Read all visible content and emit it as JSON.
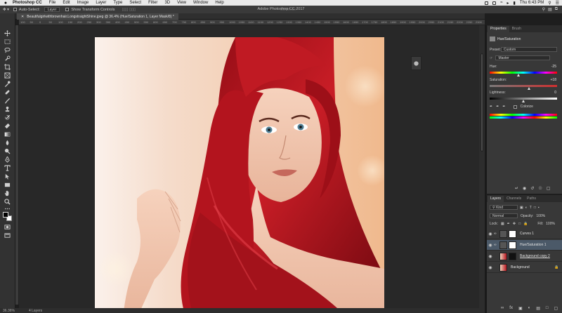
{
  "menubar": {
    "app_name": "Photoshop CC",
    "items": [
      "File",
      "Edit",
      "Image",
      "Layer",
      "Type",
      "Select",
      "Filter",
      "3D",
      "View",
      "Window",
      "Help"
    ],
    "time": "Thu 6:43 PM"
  },
  "window_title": "Adobe Photoshop CC 2017",
  "options_bar": {
    "auto_select_label": "Auto-Select:",
    "auto_select_value": "Layer",
    "show_transform_label": "Show Transform Controls",
    "mode_3d": "3D Mode:"
  },
  "document": {
    "tab_title": "Beautifulgirlwithbrownhair.LongstraightShine.jpeg @ 36.4% (Hue/Saturation 1, Layer Mask/8) *",
    "zoom": "36.36%",
    "layers_count": "4 Layers"
  },
  "ruler": [
    "100",
    "50",
    "0",
    "50",
    "100",
    "150",
    "200",
    "250",
    "300",
    "350",
    "400",
    "450",
    "500",
    "550",
    "600",
    "650",
    "700",
    "750",
    "800",
    "850",
    "900",
    "950",
    "1000",
    "1050",
    "1100",
    "1150",
    "1200",
    "1250",
    "1300",
    "1350",
    "1400",
    "1450",
    "1500",
    "1550",
    "1600",
    "1650",
    "1700",
    "1750",
    "1800",
    "1850",
    "1900",
    "1950",
    "2000",
    "2050",
    "2100",
    "2150",
    "2200",
    "2250",
    "2300",
    "2350"
  ],
  "properties": {
    "tabs": [
      "Properties",
      "Brush"
    ],
    "panel_title": "Hue/Saturation",
    "preset_label": "Preset:",
    "preset_value": "Custom",
    "channel_value": "Master",
    "hue_label": "Hue:",
    "hue_value": "-25",
    "saturation_label": "Saturation:",
    "saturation_value": "+18",
    "lightness_label": "Lightness:",
    "lightness_value": "0",
    "colorize_label": "Colorize",
    "hue_level": 0.43,
    "saturation_level": 0.59,
    "lightness_level": 0.5
  },
  "layers": {
    "tabs": [
      "Layers",
      "Channels",
      "Paths"
    ],
    "kind_value": "Kind",
    "blend_mode": "Normal",
    "opacity_label": "Opacity:",
    "opacity_value": "100%",
    "lock_label": "Lock:",
    "fill_label": "Fill:",
    "fill_value": "100%",
    "items": [
      {
        "name": "Curves 1"
      },
      {
        "name": "Hue/Saturation 1"
      },
      {
        "name": "Background copy 2"
      },
      {
        "name": "Background"
      }
    ]
  },
  "colors": {
    "accent_hair": "#b3141e",
    "selected_row": "#4b5968",
    "panel_bg": "#383838"
  }
}
